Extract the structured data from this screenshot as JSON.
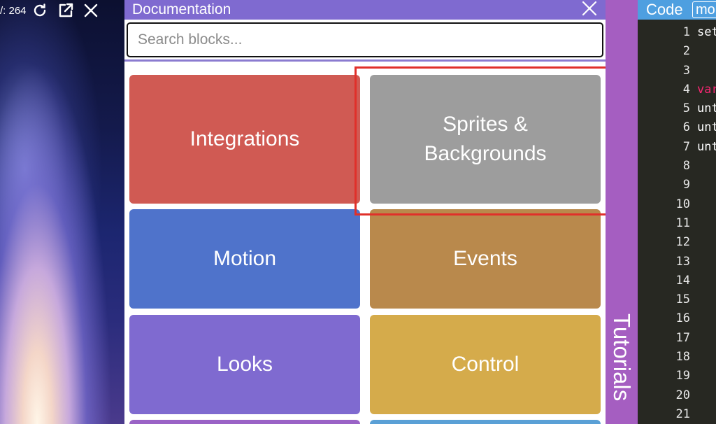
{
  "stage": {
    "coord_text": "/: 264",
    "icons": [
      "refresh-icon",
      "open-external-icon",
      "close-icon"
    ]
  },
  "docs": {
    "title": "Documentation",
    "search_placeholder": "Search blocks...",
    "close_icon": "close-icon",
    "header_color": "#7f6ad0",
    "blocks": [
      {
        "label": "Integrations",
        "color": "#d05a53"
      },
      {
        "label": "Sprites & Backgrounds",
        "color": "#9d9d9d"
      },
      {
        "label": "Motion",
        "color": "#4f73cb"
      },
      {
        "label": "Events",
        "color": "#b9894c"
      },
      {
        "label": "Looks",
        "color": "#7f6ad0"
      },
      {
        "label": "Control",
        "color": "#d5ab4b"
      }
    ]
  },
  "tutorials": {
    "label": "Tutorials",
    "color": "#a55ec1"
  },
  "code": {
    "title": "Code",
    "mode": "mo",
    "lines": [
      {
        "n": "1",
        "text": "set"
      },
      {
        "n": "2",
        "text": ""
      },
      {
        "n": "3",
        "text": ""
      },
      {
        "n": "4",
        "text": "var"
      },
      {
        "n": "5",
        "text": "unt"
      },
      {
        "n": "6",
        "text": "unt"
      },
      {
        "n": "7",
        "text": "unt"
      },
      {
        "n": "8",
        "text": ""
      },
      {
        "n": "9",
        "text": ""
      },
      {
        "n": "10",
        "text": ""
      },
      {
        "n": "11",
        "text": ""
      },
      {
        "n": "12",
        "text": ""
      },
      {
        "n": "13",
        "text": ""
      },
      {
        "n": "14",
        "text": ""
      },
      {
        "n": "15",
        "text": ""
      },
      {
        "n": "16",
        "text": ""
      },
      {
        "n": "17",
        "text": ""
      },
      {
        "n": "18",
        "text": ""
      },
      {
        "n": "19",
        "text": ""
      },
      {
        "n": "20",
        "text": ""
      },
      {
        "n": "21",
        "text": ""
      }
    ]
  }
}
